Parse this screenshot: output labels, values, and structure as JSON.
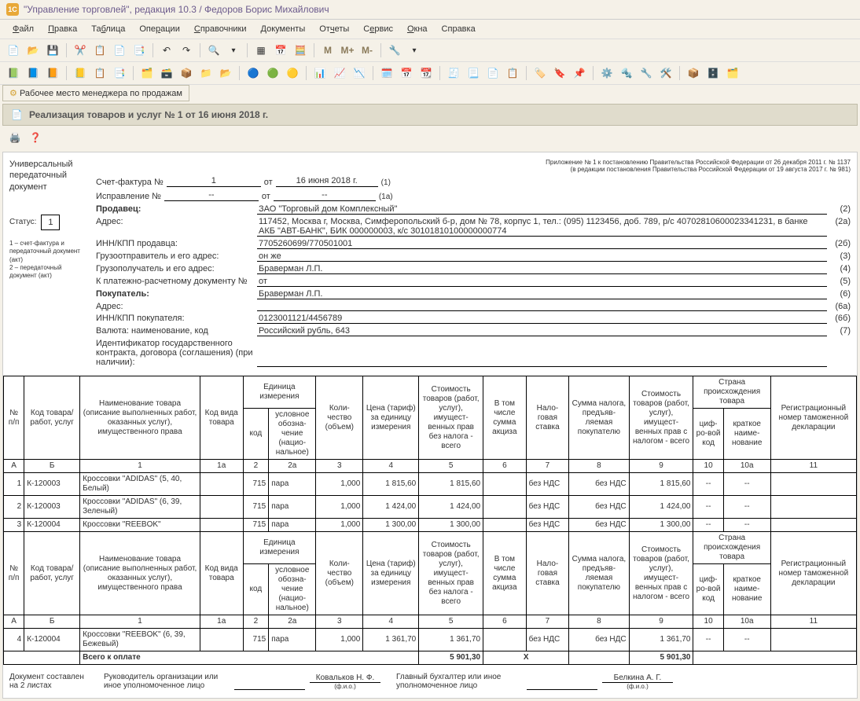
{
  "title": "\"Управление торговлей\", редакция 10.3 / Федоров Борис Михайлович",
  "menu": [
    "Файл",
    "Правка",
    "Таблица",
    "Операции",
    "Справочники",
    "Документы",
    "Отчеты",
    "Сервис",
    "Окна",
    "Справка"
  ],
  "tab_label": "Рабочее место менеджера по продажам",
  "doc_title": "Реализация товаров и услуг № 1 от 16 июня 2018 г.",
  "upd": {
    "title": "Универсальный передаточный документ",
    "status_label": "Статус:",
    "status_value": "1",
    "footnote1": "1 – счет-фактура и передаточный документ (акт)",
    "footnote2": "2 – передаточный документ (акт)"
  },
  "regnote1": "Приложение № 1 к постановлению Правительства Российской Федерации от 26 декабря 2011 г. № 1137",
  "regnote2": "(в редакции постановления Правительства Российской Федерации от 19 августа 2017 г. № 981)",
  "invoice": {
    "sf_label": "Счет-фактура №",
    "sf_no": "1",
    "sf_ot": "от",
    "sf_date": "16 июня 2018 г.",
    "sf_paren": "(1)",
    "corr_label": "Исправление №",
    "corr_no": "--",
    "corr_ot": "от",
    "corr_date": "--",
    "corr_paren": "(1а)"
  },
  "fields": [
    {
      "label": "Продавец:",
      "value": "ЗАО \"Торговый дом Комплексный\"",
      "paren": "(2)",
      "bold": true
    },
    {
      "label": "Адрес:",
      "value": "117452, Москва г, Москва, Симферопольский б-р, дом № 78, корпус 1, тел.: (095) 1123456, доб. 789, р/с 40702810600023341231, в банке АКБ \"АВТ-БАНК\", БИК 000000003, к/с 30101810100000000774",
      "paren": "(2а)"
    },
    {
      "label": "ИНН/КПП продавца:",
      "value": "7705260699/770501001",
      "paren": "(2б)"
    },
    {
      "label": "Грузоотправитель и его адрес:",
      "value": "он же",
      "paren": "(3)"
    },
    {
      "label": "Грузополучатель и его адрес:",
      "value": "Браверман Л.П.",
      "paren": "(4)"
    },
    {
      "label": "К платежно-расчетному документу №",
      "value": "от",
      "paren": "(5)"
    },
    {
      "label": "Покупатель:",
      "value": "Браверман Л.П.",
      "paren": "(6)",
      "bold": true
    },
    {
      "label": "Адрес:",
      "value": "",
      "paren": "(6а)"
    },
    {
      "label": "ИНН/КПП покупателя:",
      "value": "0123001121/4456789",
      "paren": "(6б)"
    },
    {
      "label": "Валюта: наименование, код",
      "value": "Российский рубль, 643",
      "paren": "(7)"
    },
    {
      "label": "Идентификатор государственного контракта, договора (соглашения) (при наличии):",
      "value": "",
      "paren": ""
    }
  ],
  "headers": {
    "c0": "№ п/п",
    "c1": "Код товара/ работ, услуг",
    "c2": "Наименование товара (описание выполненных работ, оказанных услуг), имущественного права",
    "c3": "Код вида товара",
    "c4g": "Единица измерения",
    "c4a": "код",
    "c4b": "условное обозна-чение (нацио-нальное)",
    "c5": "Коли-чество (объем)",
    "c6": "Цена (тариф) за единицу измерения",
    "c7": "Стоимость товаров (работ, услуг), имущест-венных прав без налога - всего",
    "c8": "В том числе сумма акциза",
    "c9": "Нало-говая ставка",
    "c10": "Сумма налога, предъяв-ляемая покупателю",
    "c11": "Стоимость товаров (работ, услуг), имущест-венных прав с налогом - всего",
    "c12g": "Страна происхождения товара",
    "c12a": "циф-ро-вой код",
    "c12b": "краткое наиме-нование",
    "c13": "Регистрационный номер таможенной декларации"
  },
  "colnums": [
    "А",
    "Б",
    "1",
    "1а",
    "2",
    "2а",
    "3",
    "4",
    "5",
    "6",
    "7",
    "8",
    "9",
    "10",
    "10а",
    "11"
  ],
  "rows1": [
    {
      "n": "1",
      "code": "К-120003",
      "name": "Кроссовки \"ADIDAS\" (5, 40, Белый)",
      "kind": "",
      "ucode": "715",
      "uname": "пара",
      "qty": "1,000",
      "price": "1 815,60",
      "cost": "1 815,60",
      "excise": "",
      "rate": "без НДС",
      "tax": "без НДС",
      "total": "1 815,60",
      "ccode": "--",
      "cname": "--",
      "decl": ""
    },
    {
      "n": "2",
      "code": "К-120003",
      "name": "Кроссовки \"ADIDAS\" (6, 39, Зеленый)",
      "kind": "",
      "ucode": "715",
      "uname": "пара",
      "qty": "1,000",
      "price": "1 424,00",
      "cost": "1 424,00",
      "excise": "",
      "rate": "без НДС",
      "tax": "без НДС",
      "total": "1 424,00",
      "ccode": "--",
      "cname": "--",
      "decl": ""
    },
    {
      "n": "3",
      "code": "К-120004",
      "name": "Кроссовки \"REEBOK\"",
      "kind": "",
      "ucode": "715",
      "uname": "пара",
      "qty": "1,000",
      "price": "1 300,00",
      "cost": "1 300,00",
      "excise": "",
      "rate": "без НДС",
      "tax": "без НДС",
      "total": "1 300,00",
      "ccode": "--",
      "cname": "--",
      "decl": ""
    }
  ],
  "rows2": [
    {
      "n": "4",
      "code": "К-120004",
      "name": "Кроссовки \"REEBOK\" (6, 39, Бежевый)",
      "kind": "",
      "ucode": "715",
      "uname": "пара",
      "qty": "1,000",
      "price": "1 361,70",
      "cost": "1 361,70",
      "excise": "",
      "rate": "без НДС",
      "tax": "без НДС",
      "total": "1 361,70",
      "ccode": "--",
      "cname": "--",
      "decl": ""
    }
  ],
  "total": {
    "label": "Всего к оплате",
    "cost": "5 901,30",
    "x": "Х",
    "total": "5 901,30"
  },
  "sign": {
    "sheets": "Документ составлен на 2 листах",
    "head_label": "Руководитель организации или иное уполномоченное лицо",
    "head_name": "Ковальков Н. Ф.",
    "acc_label": "Главный бухгалтер или иное уполномоченное лицо",
    "acc_name": "Белкина А. Г.",
    "fio": "(ф.и.о.)"
  }
}
